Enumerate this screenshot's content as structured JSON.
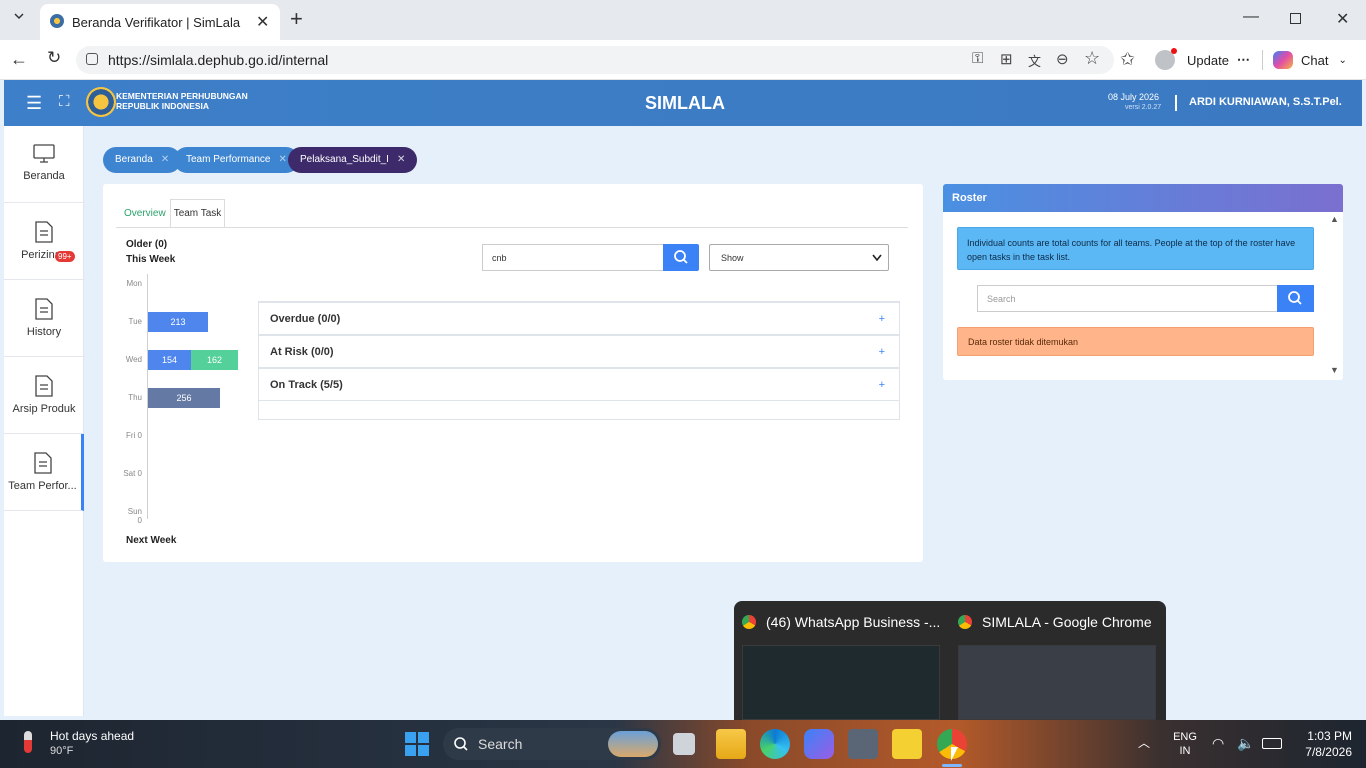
{
  "browser": {
    "tab_title": "Beranda Verifikator | SimLala",
    "url": "https://simlala.dephub.go.id/internal",
    "update_label": "Update",
    "chat_label": "Chat"
  },
  "header": {
    "org_line1": "KEMENTERIAN PERHUBUNGAN",
    "org_line2": "REPUBLIK INDONESIA",
    "app_title": "SIMLALA",
    "date": "08 July 2026",
    "version": "versi 2.0.27",
    "user": "ARDI KURNIAWAN, S.S.T.Pel."
  },
  "sidebar": {
    "items": [
      {
        "label": "Beranda",
        "icon": "monitor-icon"
      },
      {
        "label": "Perizinan",
        "icon": "document-icon",
        "badge": "99+"
      },
      {
        "label": "History",
        "icon": "document-icon"
      },
      {
        "label": "Arsip Produk",
        "icon": "document-icon"
      },
      {
        "label": "Team Perfor...",
        "icon": "document-icon"
      }
    ]
  },
  "breadcrumbs": [
    "Beranda",
    "Team Performance",
    "Pelaksana_Subdit_I"
  ],
  "tabs": [
    "Overview",
    "Team Task"
  ],
  "chart": {
    "older": "Older (0)",
    "this_week": "This Week",
    "next_week": "Next Week"
  },
  "chart_data": {
    "type": "bar",
    "categories": [
      "Mon",
      "Tue",
      "Wed",
      "Thu",
      "Fri",
      "Sat",
      "Sun"
    ],
    "series": [
      {
        "values": [
          0,
          213,
          154,
          256,
          0,
          0,
          0
        ],
        "color": "#4f86ee"
      },
      {
        "values": [
          0,
          0,
          162,
          0,
          0,
          0,
          0
        ],
        "color": "#54d09a"
      }
    ],
    "category_labels": [
      "Mon",
      "Tue",
      "Wed",
      "Thu",
      "Fri 0",
      "Sat 0",
      "Sun 0"
    ],
    "bar_labels": {
      "Tue": [
        "213"
      ],
      "Wed": [
        "154",
        "162"
      ],
      "Thu": [
        "256"
      ]
    },
    "thu_color": "#6479a3"
  },
  "search": {
    "value": "cnb",
    "show_label": "Show"
  },
  "sections": [
    {
      "label": "Overdue (0/0)"
    },
    {
      "label": "At Risk (0/0)"
    },
    {
      "label": "On Track (5/5)"
    }
  ],
  "roster": {
    "title": "Roster",
    "info": "Individual counts are total counts for all teams. People at the top of the roster have open tasks in the task list.",
    "search_placeholder": "Search",
    "empty": "Data roster tidak ditemukan"
  },
  "thumbnails": [
    {
      "title": "(46) WhatsApp Business -..."
    },
    {
      "title": "SIMLALA - Google Chrome"
    }
  ],
  "taskbar": {
    "weather_title": "Hot days ahead",
    "weather_temp": "90°F",
    "search_label": "Search",
    "lang1": "ENG",
    "lang2": "IN",
    "time": "1:03 PM",
    "date": "7/8/2026"
  }
}
